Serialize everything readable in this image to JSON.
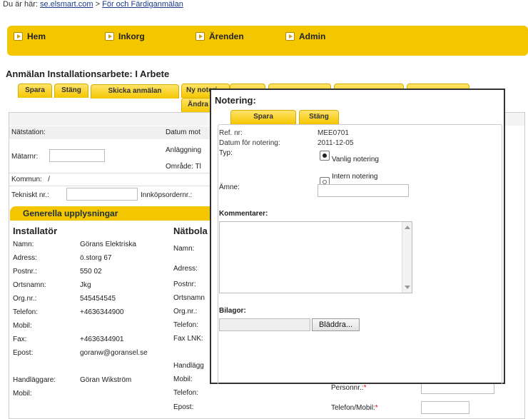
{
  "breadcrumb": {
    "prefix": "Du är här:",
    "home": "se.elsmart.com",
    "separator": ">",
    "current": "För och Färdiganmälan"
  },
  "nav": {
    "items": [
      {
        "label": "Hem"
      },
      {
        "label": "Inkorg"
      },
      {
        "label": "Ärenden"
      },
      {
        "label": "Admin"
      }
    ]
  },
  "page": {
    "title": "Anmälan Installationsarbete: I Arbete"
  },
  "tabs": {
    "spara": "Spara",
    "stang": "Stäng",
    "skicka": "Skicka anmälan",
    "ny_notering": "Ny noteri",
    "andra": "Ändra"
  },
  "form": {
    "natstation": "Nätstation:",
    "datum_mot": "Datum mot",
    "anlaggning": "Anläggning",
    "matarnr": "Mätarnr:",
    "omrade": "Område: Tl",
    "kommun": "Kommun:   /",
    "tekniskt_nr": "Tekniskt nr.:",
    "innkopsorder": "Innköpsordernr.:"
  },
  "section": {
    "title": "Generella upplysningar"
  },
  "installator": {
    "heading": "Installatör",
    "rows": [
      {
        "label": "Namn:",
        "value": "Görans Elektriska"
      },
      {
        "label": "Adress:",
        "value": "ö.storg 67"
      },
      {
        "label": "Postnr.:",
        "value": "550 02"
      },
      {
        "label": "Ortsnamn:",
        "value": "Jkg"
      },
      {
        "label": "Org.nr.:",
        "value": "545454545"
      },
      {
        "label": "Telefon:",
        "value": "+4636344900"
      },
      {
        "label": "Mobil:",
        "value": ""
      },
      {
        "label": "Fax:",
        "value": "+4636344901"
      },
      {
        "label": "Epost:",
        "value": "goranw@goransel.se"
      }
    ],
    "handlaggare_label": "Handläggare:",
    "handlaggare_value": "Göran Wikström",
    "mobil2": "Mobil:"
  },
  "natbolag": {
    "heading": "Nätbola",
    "rows": [
      "Namn:",
      "Adress:",
      "Postnr:",
      "Ortsnamn",
      "Org.nr.:",
      "Telefon:",
      "Fax LNK:"
    ],
    "handlagg": "Handlägg",
    "rows2": [
      "Mobil:",
      "Telefon:",
      "Epost:"
    ]
  },
  "right_extra": {
    "personnr": "Personnr.:",
    "telefon_mobil": "Telefon/Mobil:",
    "required_mark": "*"
  },
  "modal": {
    "title": "Notering:",
    "save_label": "Spara",
    "close_label": "Stäng",
    "ref_label": "Ref. nr:",
    "ref_value": "MEE0701",
    "datum_label": "Datum för notering:",
    "datum_value": "2011-12-05",
    "typ_label": "Typ:",
    "typ_option1": "Vanlig notering",
    "typ_option2": "Intern notering",
    "amne_label": "Ämne:",
    "amne_value": "",
    "kommentarer_label": "Kommentarer:",
    "kommentarer_value": "",
    "bilagor_label": "Bilagor:",
    "browse_label": "Bläddra..."
  },
  "colors": {
    "accent": "#f4c600",
    "link": "#1a3a8a"
  }
}
